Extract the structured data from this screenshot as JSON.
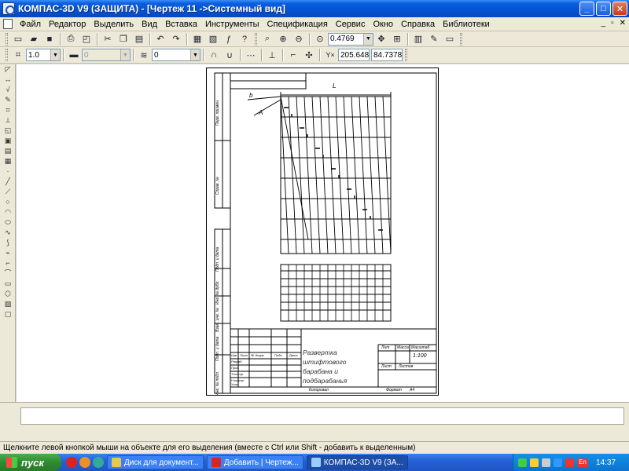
{
  "window": {
    "title": "КОМПАС-3D V9 (ЗАЩИТА) - [Чертеж 11 ->Системный вид]",
    "minimize": "_",
    "maximize": "□",
    "close": "✕"
  },
  "menu": {
    "items": [
      "Файл",
      "Редактор",
      "Выделить",
      "Вид",
      "Вставка",
      "Инструменты",
      "Спецификация",
      "Сервис",
      "Окно",
      "Справка",
      "Библиотеки"
    ],
    "doc_controls": [
      "_",
      "▫",
      "✕"
    ]
  },
  "toolbar1": {
    "zoom_value": "0.4769"
  },
  "toolbar2": {
    "step_value": "1.0",
    "style_value": "0",
    "layer_value": "0",
    "coord_x": "205.648",
    "coord_y": "84.7378"
  },
  "drawing": {
    "dim_L": "L",
    "dim_b": "b",
    "leader_A": "A",
    "title_block_text": "Развертка штифтового барабана и подбарабанья",
    "scale": "1:100",
    "col_lit": "Лит",
    "col_mass": "Масса",
    "col_scale": "Масштаб",
    "col_sheet": "Лист",
    "col_sheets": "Листов",
    "row_changes": [
      "Изм",
      "Лист",
      "№ докум.",
      "Подп.",
      "Дата"
    ],
    "row_roles": [
      "Разраб.",
      "Пров.",
      "Т.контр.",
      "Н.контр.",
      "Утв."
    ],
    "side_labels": [
      "Перв. примен.",
      "Справ. №",
      "Подп. и дата",
      "Инв. № дубл.",
      "Взам. инв. №",
      "Подп. и дата",
      "Инв. № подл."
    ],
    "copied": "Копировал",
    "format": "Формат",
    "format_value": "A4"
  },
  "status": {
    "message": "Щелкните левой кнопкой мыши на объекте для его выделения (вместе с Ctrl или Shift - добавить к выделенным)"
  },
  "taskbar": {
    "start": "пуск",
    "tasks": [
      "Диск для документ...",
      "Добавить | Чертеж...",
      "КОМПАС-3D V9 (ЗА..."
    ],
    "lang": "EN",
    "tray_lang": "En",
    "clock": "14:37"
  },
  "colors": {
    "titlebar": "#0553d0",
    "taskbar": "#2462d6",
    "start": "#2f8a2f"
  }
}
